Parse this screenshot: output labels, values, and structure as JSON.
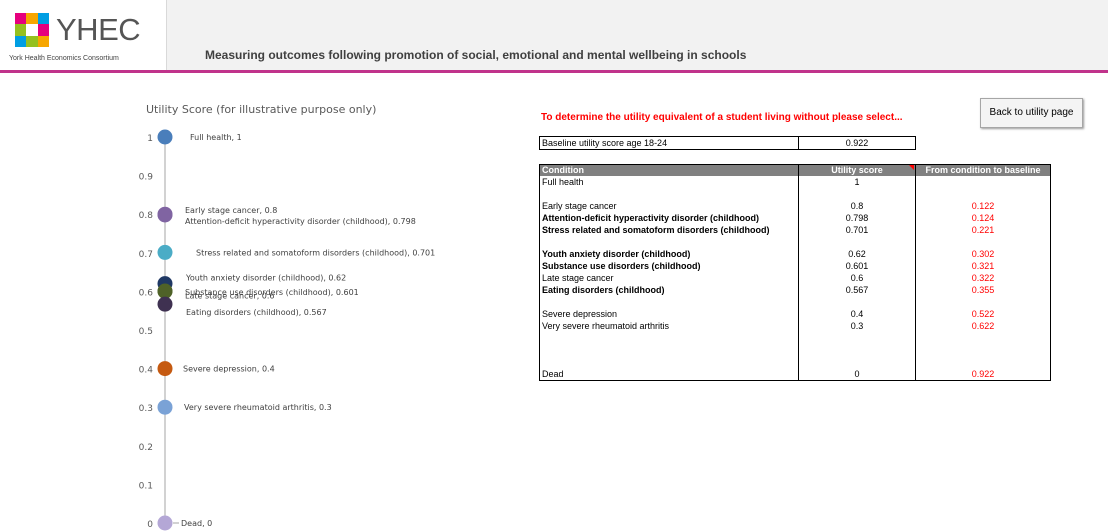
{
  "header": {
    "logo_text": "YHEC",
    "logo_subtitle": "York Health Economics Consortium",
    "title": "Measuring outcomes following promotion of social, emotional and mental wellbeing in schools",
    "accent_color": "#c0338b"
  },
  "chart_data": {
    "type": "scatter",
    "title": "Utility Score (for illustrative purpose only)",
    "xlabel": "",
    "ylabel": "",
    "ylim": [
      0,
      1
    ],
    "yticks": [
      "1",
      "0.9",
      "0.8",
      "0.7",
      "0.6",
      "0.5",
      "0.4",
      "0.3",
      "0.2",
      "0.1",
      "0"
    ],
    "grid": false,
    "points": [
      {
        "label": "Full health, 1",
        "value": 1,
        "color": "#4a7ebb"
      },
      {
        "label": "Early stage cancer, 0.8",
        "value": 0.8,
        "color": "#8064a2"
      },
      {
        "label": "Attention-deficit hyperactivity disorder (childhood), 0.798",
        "value": 0.798,
        "color": "#8064a2"
      },
      {
        "label": "Stress related and somatoform disorders (childhood), 0.701",
        "value": 0.701,
        "color": "#4bacc6"
      },
      {
        "label": "Youth anxiety disorder (childhood), 0.62",
        "value": 0.62,
        "color": "#1f3864"
      },
      {
        "label": "Substance use disorders (childhood), 0.601",
        "value": 0.601,
        "color": "#4f6228"
      },
      {
        "label": "Late stage cancer, 0.6",
        "value": 0.6,
        "color": "#4f6228"
      },
      {
        "label": "Eating disorders (childhood), 0.567",
        "value": 0.567,
        "color": "#3f3151"
      },
      {
        "label": "Severe depression, 0.4",
        "value": 0.4,
        "color": "#c55a11"
      },
      {
        "label": "Very severe rheumatoid arthritis, 0.3",
        "value": 0.3,
        "color": "#7aa2d6"
      },
      {
        "label": "Dead, 0",
        "value": 0,
        "color": "#b4a7d6"
      }
    ]
  },
  "instruction": "To determine the utility equivalent of a student living without please select...",
  "back_button": "Back to utility page",
  "baseline": {
    "label": "Baseline utility score age 18-24",
    "value": "0.922"
  },
  "table": {
    "headers": [
      "Condition",
      "Utility score",
      "From condition to baseline"
    ],
    "rows": [
      {
        "condition": "Full health",
        "utility": "1",
        "diff": "",
        "bold": false
      },
      {
        "condition": "",
        "utility": "",
        "diff": "",
        "bold": false
      },
      {
        "condition": "Early stage cancer",
        "utility": "0.8",
        "diff": "0.122",
        "bold": false
      },
      {
        "condition": "Attention-deficit hyperactivity disorder (childhood)",
        "utility": "0.798",
        "diff": "0.124",
        "bold": true
      },
      {
        "condition": "Stress related and somatoform disorders (childhood)",
        "utility": "0.701",
        "diff": "0.221",
        "bold": true
      },
      {
        "condition": "",
        "utility": "",
        "diff": "",
        "bold": false
      },
      {
        "condition": "Youth anxiety disorder (childhood)",
        "utility": "0.62",
        "diff": "0.302",
        "bold": true
      },
      {
        "condition": "Substance use disorders (childhood)",
        "utility": "0.601",
        "diff": "0.321",
        "bold": true
      },
      {
        "condition": "Late stage cancer",
        "utility": "0.6",
        "diff": "0.322",
        "bold": false
      },
      {
        "condition": "Eating disorders (childhood)",
        "utility": "0.567",
        "diff": "0.355",
        "bold": true
      },
      {
        "condition": "",
        "utility": "",
        "diff": "",
        "bold": false
      },
      {
        "condition": "Severe depression",
        "utility": "0.4",
        "diff": "0.522",
        "bold": false
      },
      {
        "condition": "Very severe rheumatoid arthritis",
        "utility": "0.3",
        "diff": "0.622",
        "bold": false
      },
      {
        "condition": "",
        "utility": "",
        "diff": "",
        "bold": false
      },
      {
        "condition": "",
        "utility": "",
        "diff": "",
        "bold": false
      },
      {
        "condition": "",
        "utility": "",
        "diff": "",
        "bold": false
      },
      {
        "condition": "Dead",
        "utility": "0",
        "diff": "0.922",
        "bold": false
      }
    ]
  }
}
